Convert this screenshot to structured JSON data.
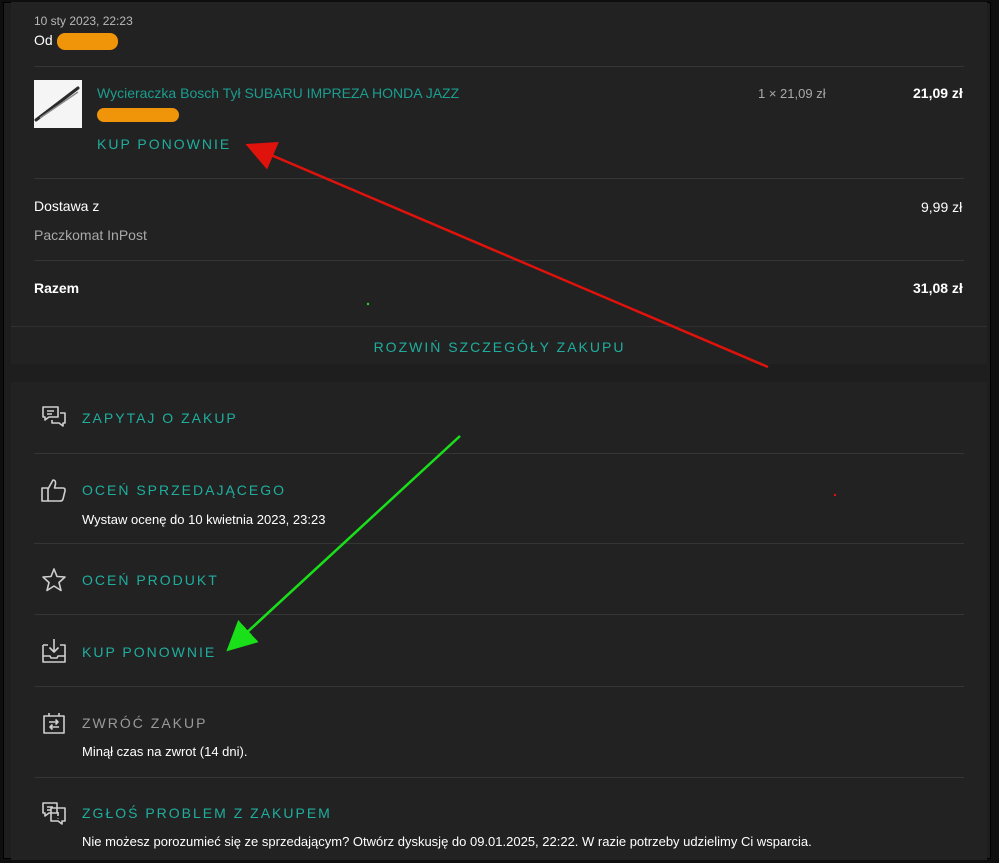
{
  "order": {
    "date": "10 sty 2023, 22:23",
    "from_label": "Od"
  },
  "item": {
    "title": "Wycieraczka Bosch Tył SUBARU IMPREZA HONDA JAZZ",
    "unit_price": "1 × 21,09 zł",
    "total": "21,09 zł",
    "buy_again": "KUP PONOWNIE"
  },
  "delivery": {
    "label": "Dostawa z",
    "method": "Paczkomat InPost",
    "price": "9,99 zł"
  },
  "summary": {
    "label": "Razem",
    "total": "31,08 zł"
  },
  "expand_label": "ROZWIŃ SZCZEGÓŁY ZAKUPU",
  "actions": [
    {
      "label": "ZAPYTAJ O ZAKUP",
      "icon": "chat-bubbles-icon"
    },
    {
      "label": "OCEŃ SPRZEDAJĄCEGO",
      "note": "Wystaw ocenę do 10 kwietnia 2023, 23:23",
      "icon": "thumbs-up-icon"
    },
    {
      "label": "OCEŃ PRODUKT",
      "icon": "star-icon"
    },
    {
      "label": "KUP PONOWNIE",
      "icon": "box-download-icon"
    },
    {
      "label": "ZWRÓĆ ZAKUP",
      "note": "Minął czas na zwrot (14 dni).",
      "icon": "return-icon",
      "disabled": true
    },
    {
      "label": "ZGŁOŚ PROBLEM Z ZAKUPEM",
      "note": "Nie możesz porozumieć się ze sprzedającym? Otwórz dyskusję do 09.01.2025, 22:22. W razie potrzeby udzielimy Ci wsparcia.",
      "icon": "report-chat-icon"
    }
  ],
  "colors": {
    "accent": "#1fae9e",
    "redaction": "#f0940a",
    "arrow_red": "#e0120c",
    "arrow_green": "#19e019"
  }
}
